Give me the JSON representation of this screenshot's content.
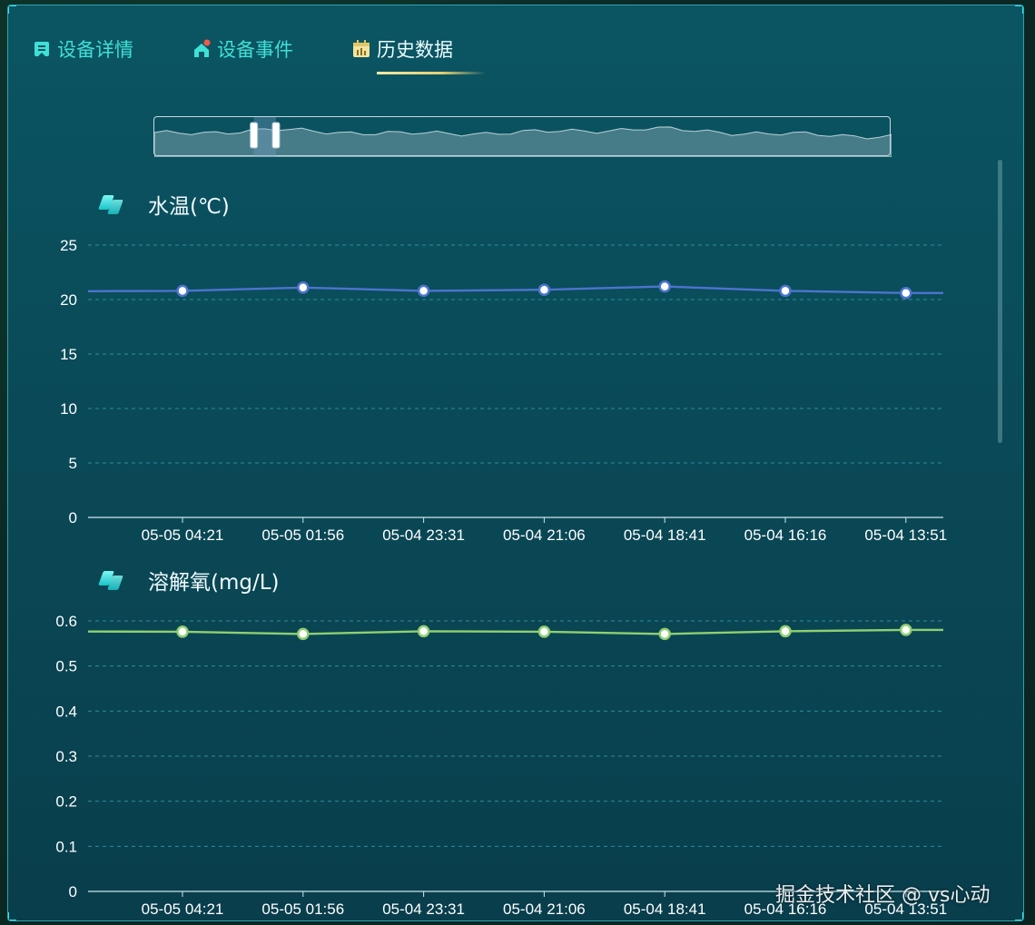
{
  "tabs": [
    {
      "label": "设备详情",
      "icon": "detail-icon",
      "active": false
    },
    {
      "label": "设备事件",
      "icon": "event-icon",
      "active": false
    },
    {
      "label": "历史数据",
      "icon": "history-icon",
      "active": true
    }
  ],
  "colors": {
    "accent": "#3fe0d8",
    "active_tab_underline": "#e3cf72",
    "temp_line": "#4c74cf",
    "oxygen_line": "#8fcf72",
    "gridline": "#2a8f99"
  },
  "watermark": "掘金技术社区 @ vs心动",
  "chart_data": [
    {
      "type": "line",
      "title": "水温(℃)",
      "xlabel": "",
      "ylabel": "",
      "ylim": [
        0,
        25
      ],
      "yticks": [
        0,
        5,
        10,
        15,
        20,
        25
      ],
      "categories": [
        "05-05 04:21",
        "05-05 01:56",
        "05-04 23:31",
        "05-04 21:06",
        "05-04 18:41",
        "05-04 16:16",
        "05-04 13:51"
      ],
      "values": [
        20.8,
        21.1,
        20.8,
        20.9,
        21.2,
        20.8,
        20.6
      ],
      "grid": true,
      "legend": "none"
    },
    {
      "type": "line",
      "title": "溶解氧(mg/L)",
      "xlabel": "",
      "ylabel": "",
      "ylim": [
        0,
        0.6
      ],
      "yticks": [
        0,
        0.1,
        0.2,
        0.3,
        0.4,
        0.5,
        0.6
      ],
      "categories": [
        "05-05 04:21",
        "05-05 01:56",
        "05-04 23:31",
        "05-04 21:06",
        "05-04 18:41",
        "05-04 16:16",
        "05-04 13:51"
      ],
      "values": [
        0.576,
        0.571,
        0.577,
        0.576,
        0.571,
        0.577,
        0.58
      ],
      "grid": true,
      "legend": "none"
    }
  ],
  "zoom_window": {
    "start_fraction": 0.135,
    "end_fraction": 0.165
  }
}
